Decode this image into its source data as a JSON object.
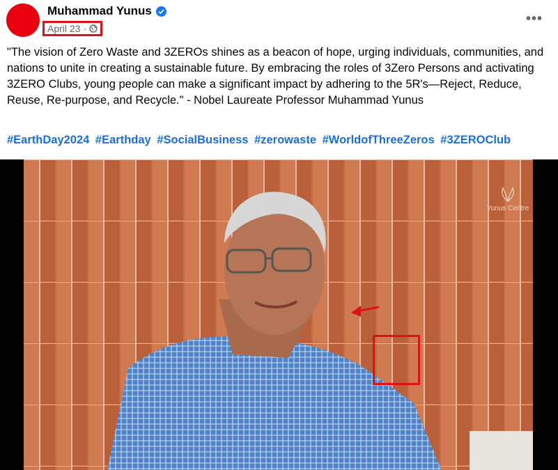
{
  "post": {
    "author": "Muhammad Yunus",
    "date": "April 23",
    "separator": "·",
    "audience_icon": "globe-icon",
    "more_icon": "more-options-icon",
    "body": "\"The vision of Zero Waste and 3ZEROs shines as a beacon of hope, urging individuals, communities, and nations to unite in creating a sustainable future. By embracing the roles of 3Zero Persons and activating 3ZERO Clubs, young people can make a significant impact by adhering to the 5R's—Reject, Reduce, Reuse, Re-purpose, and Recycle.\" - Nobel Laureate Professor Muhammad Yunus",
    "hashtags": [
      "#EarthDay2024",
      "#Earthday",
      "#SocialBusiness",
      "#zerowaste",
      "#WorldofThreeZeros",
      "#3ZEROClub"
    ]
  },
  "video": {
    "watermark": "Yunus Centre"
  },
  "colors": {
    "avatar": "#e8000f",
    "verified": "#1877f2",
    "hashtag": "#1a6ed8",
    "annotation": "#e0101a",
    "brick": "#c26c44"
  }
}
